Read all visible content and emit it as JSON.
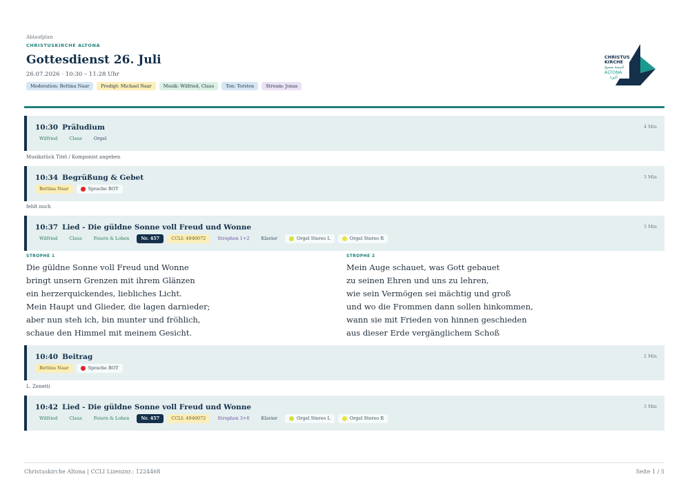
{
  "header": {
    "kicker": "Ablaufplan",
    "church": "CHRISTUSKIRCHE ALTONA",
    "title": "Gottesdienst 26. Juli",
    "date": "26.07.2026 · 10:30 – 11:28 Uhr",
    "tags": [
      {
        "label": "Moderation: Bettina Naar",
        "color": "#d6e6f5"
      },
      {
        "label": "Predigt: Michael Naar",
        "color": "#fbeeb8"
      },
      {
        "label": "Musik: Wilfried, Claus",
        "color": "#d9f0e4"
      },
      {
        "label": "Ton: Torsten",
        "color": "#d6e6f5"
      },
      {
        "label": "Stream: Jonas",
        "color": "#ebe1f5"
      }
    ]
  },
  "logo": {
    "line1": "CHRISTUS",
    "line2": "KIRCHE",
    "arabic": "كنيسة مسيح",
    "line3": "ALTONA",
    "arabic2": "ألتونا",
    "colors": {
      "navy": "#14304a",
      "teal": "#1d9a8f",
      "green": "#1d7f7a"
    }
  },
  "items": [
    {
      "time": "10:30",
      "title": "Präludium",
      "duration": "4 Min",
      "chips": [
        {
          "label": "Wilfried",
          "style": "green"
        },
        {
          "label": "Claus",
          "style": "green"
        },
        {
          "label": "Orgel",
          "style": "plain"
        }
      ],
      "note": "Musikstück Titel / Komponist angeben"
    },
    {
      "time": "10:34",
      "title": "Begrüßung & Gebet",
      "duration": "3 Min",
      "chips": [
        {
          "label": "Bettina Naar",
          "style": "yellow"
        },
        {
          "label": "Sprache ROT",
          "style": "white",
          "dot": "#e02424"
        }
      ],
      "note": "fehlt noch"
    },
    {
      "time": "10:37",
      "title": "Lied - Die güldne Sonne voll Freud und Wonne",
      "duration": "3 Min",
      "chips": [
        {
          "label": "Wilfried",
          "style": "green"
        },
        {
          "label": "Claus",
          "style": "green"
        },
        {
          "label": "Feiern & Loben",
          "style": "green"
        },
        {
          "label": "Nr. 457",
          "style": "dark"
        },
        {
          "label": "CCLI: 4940072",
          "style": "yellow"
        },
        {
          "label": "Strophen 1+2",
          "style": "purple"
        },
        {
          "label": "Klavier",
          "style": "plain"
        },
        {
          "label": "Orgel Stereo L",
          "style": "white",
          "dot": "#d8e03a"
        },
        {
          "label": "Orgel Stereo R",
          "style": "white",
          "dot": "#e8e43a"
        }
      ]
    },
    {
      "time": "10:40",
      "title": "Beitrag",
      "duration": "2 Min",
      "chips": [
        {
          "label": "Bettina Naar",
          "style": "yellow"
        },
        {
          "label": "Sprache ROT",
          "style": "white",
          "dot": "#e02424"
        }
      ],
      "note": "L. Zenetti"
    },
    {
      "time": "10:42",
      "title": "Lied - Die güldne Sonne voll Freud und Wonne",
      "duration": "3 Min",
      "chips": [
        {
          "label": "Wilfried",
          "style": "green"
        },
        {
          "label": "Claus",
          "style": "green"
        },
        {
          "label": "Feiern & Loben",
          "style": "green"
        },
        {
          "label": "Nr. 457",
          "style": "dark"
        },
        {
          "label": "CCLI: 4940072",
          "style": "yellow"
        },
        {
          "label": "Strophen 3+6",
          "style": "purple"
        },
        {
          "label": "Klavier",
          "style": "plain"
        },
        {
          "label": "Orgel Stereo L",
          "style": "white",
          "dot": "#d8e03a"
        },
        {
          "label": "Orgel Stereo R",
          "style": "white",
          "dot": "#e8e43a"
        }
      ]
    }
  ],
  "verses": [
    {
      "label": "STROPHE 1",
      "lines": [
        "Die güldne Sonne voll Freud und Wonne",
        "bringt unsern Grenzen mit ihrem Glänzen",
        "ein herzerquickendes, liebliches Licht.",
        "Mein Haupt und Glieder, die lagen darnieder;",
        "aber nun steh ich, bin munter und fröhlich,",
        "schaue den Himmel mit meinem Gesicht."
      ]
    },
    {
      "label": "STROPHE 2",
      "lines": [
        "Mein Auge schauet, was Gott gebauet",
        "zu seinen Ehren und uns zu lehren,",
        "wie sein Vermögen sei mächtig und groß",
        "und wo die Frommen dann sollen hinkommen,",
        "wann sie mit Frieden von hinnen geschieden",
        "aus dieser Erde vergänglichem Schoß"
      ]
    }
  ],
  "footer": {
    "left": "Christuskirche Altona | CCLI Lizenznr.: 1224468",
    "right": "Seite 1 / 5"
  }
}
